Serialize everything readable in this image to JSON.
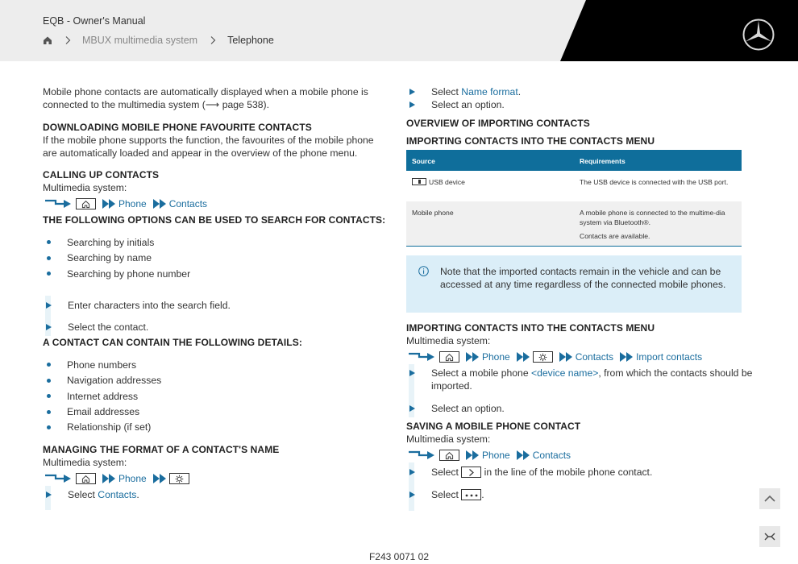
{
  "header": {
    "doc_title": "EQB - Owner's Manual",
    "breadcrumb": [
      "MBUX multimedia system",
      "Telephone"
    ]
  },
  "left": {
    "intro_1": "Mobile phone contacts are automatically displayed when a mobile phone is",
    "intro_2": "connected to the multimedia system (⟶ page 538).",
    "downloading": {
      "heading": "DOWNLOADING MOBILE PHONE FAVOURITE CONTACTS",
      "line_1": "If the mobile phone supports the function, the favourites of the mobile phone",
      "line_2": "are automatically loaded and appear in the overview of the phone menu."
    },
    "calling": {
      "heading": "CALLING UP CONTACTS",
      "system": "Multimedia system:",
      "nav": [
        "Phone",
        "Contacts"
      ]
    },
    "search": {
      "heading": "THE FOLLOWING OPTIONS CAN BE USED TO SEARCH FOR CONTACTS:",
      "bullets": [
        "Searching by initials",
        "Searching by name",
        "Searching by phone number"
      ],
      "step_1": "Enter characters into the search field.",
      "step_2": "Select the contact."
    },
    "details": {
      "heading": "A CONTACT CAN CONTAIN THE FOLLOWING DETAILS:",
      "bullets": [
        "Phone numbers",
        "Navigation addresses",
        "Internet address",
        "Email addresses",
        "Relationship (if set)"
      ]
    },
    "managing": {
      "heading": "MANAGING THE FORMAT OF A CONTACT'S NAME",
      "system": "Multimedia system:",
      "nav": [
        "Phone"
      ],
      "step_prefix": "Select ",
      "step_link": "Contacts",
      "step_suffix": "."
    }
  },
  "right": {
    "step_1_prefix": "Select ",
    "step_1_link": "Name format",
    "step_1_suffix": ".",
    "step_2": "Select an option.",
    "overview_heading": "OVERVIEW OF IMPORTING CONTACTS",
    "table_heading": "IMPORTING CONTACTS INTO THE CONTACTS MENU",
    "table": {
      "headers": [
        "Source",
        "Requirements"
      ],
      "rows": [
        {
          "source": "USB device",
          "req_1": "The USB device is connected with the USB port.",
          "req_2": ""
        },
        {
          "source": "Mobile phone",
          "req_1": "A mobile phone is connected to the multime-dia system via Bluetooth®.",
          "req_2": "Contacts are available."
        }
      ]
    },
    "note": "Note that the imported contacts remain in the vehicle and can be accessed at any time regardless of the connected mobile phones.",
    "importing": {
      "heading": "IMPORTING CONTACTS INTO THE CONTACTS MENU",
      "system": "Multimedia system:",
      "nav": [
        "Phone",
        "Contacts",
        "Import contacts"
      ],
      "step_1_prefix": "Select a mobile phone ",
      "step_1_link": "<device name>",
      "step_1_suffix": ", from which the contacts should be",
      "step_1_cont": "imported.",
      "step_2": "Select an option."
    },
    "saving": {
      "heading": "SAVING A MOBILE PHONE CONTACT",
      "system": "Multimedia system:",
      "nav": [
        "Phone",
        "Contacts"
      ],
      "step_1_prefix": "Select ",
      "step_1_suffix": " in the line of the mobile phone contact.",
      "step_2_prefix": "Select ",
      "step_2_suffix": "."
    }
  },
  "footer": "F243 0071 02",
  "colors": {
    "accent": "#1a6d9e",
    "table_header": "#0f6e9b",
    "note_bg": "#dbeef8",
    "header_bg": "#ededed"
  }
}
